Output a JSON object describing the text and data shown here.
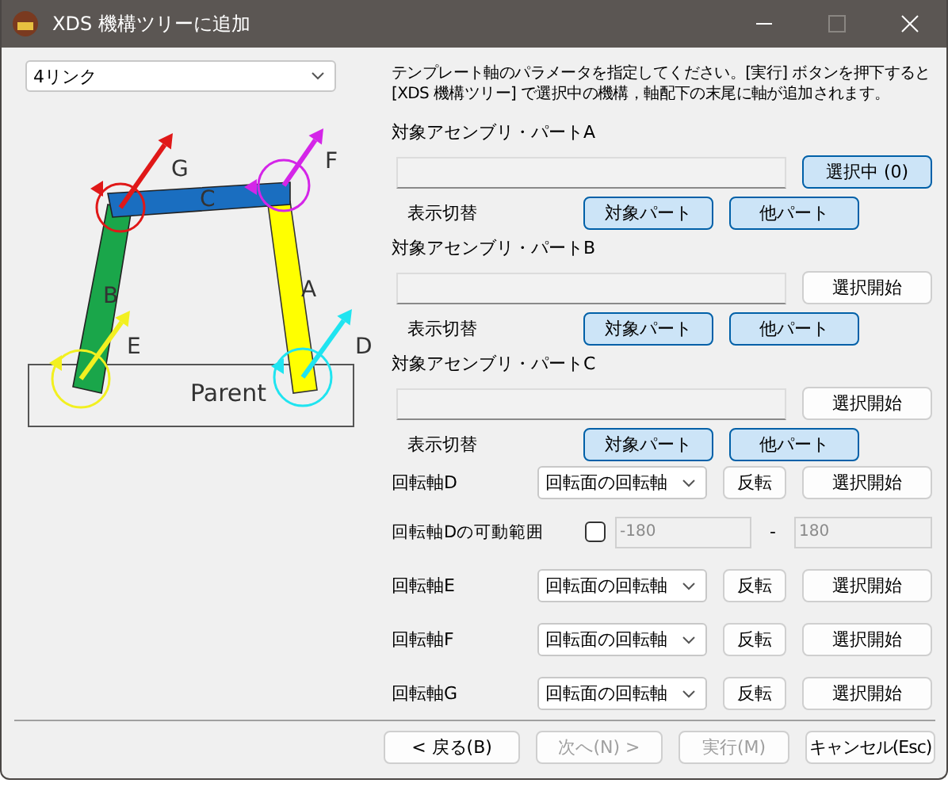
{
  "window": {
    "title": "XDS 機構ツリーに追加"
  },
  "preset": {
    "value": "4リンク"
  },
  "diagram": {
    "labels": [
      "G",
      "F",
      "C",
      "B",
      "A",
      "E",
      "D",
      "Parent"
    ]
  },
  "description": [
    "テンプレート軸のパラメータを指定してください。[実行] ボタンを押下すると",
    "[XDS 機構ツリー] で選択中の機構，軸配下の末尾に軸が追加されます。"
  ],
  "parts": [
    {
      "label": "対象アセンブリ・パートA",
      "button": {
        "label": "選択中 (0)",
        "selected": true
      },
      "display_label": "表示切替",
      "toggles": [
        {
          "label": "対象パート",
          "on": true
        },
        {
          "label": "他パート",
          "on": true
        }
      ]
    },
    {
      "label": "対象アセンブリ・パートB",
      "button": {
        "label": "選択開始",
        "selected": false
      },
      "display_label": "表示切替",
      "toggles": [
        {
          "label": "対象パート",
          "on": true
        },
        {
          "label": "他パート",
          "on": true
        }
      ]
    },
    {
      "label": "対象アセンブリ・パートC",
      "button": {
        "label": "選択開始",
        "selected": false
      },
      "display_label": "表示切替",
      "toggles": [
        {
          "label": "対象パート",
          "on": true
        },
        {
          "label": "他パート",
          "on": true
        }
      ]
    }
  ],
  "axis_rows": [
    {
      "kind": "axis",
      "label": "回転軸D",
      "mode": "回転面の回転軸",
      "reverse": "反転",
      "start": "選択開始"
    },
    {
      "kind": "range",
      "label": "回転軸Dの可動範囲",
      "checked": false,
      "min": "-180",
      "separator": "-",
      "max": "180"
    },
    {
      "kind": "axis",
      "label": "回転軸E",
      "mode": "回転面の回転軸",
      "reverse": "反転",
      "start": "選択開始"
    },
    {
      "kind": "axis",
      "label": "回転軸F",
      "mode": "回転面の回転軸",
      "reverse": "反転",
      "start": "選択開始"
    },
    {
      "kind": "axis",
      "label": "回転軸G",
      "mode": "回転面の回転軸",
      "reverse": "反転",
      "start": "選択開始"
    }
  ],
  "footer_buttons": [
    {
      "label": "< 戻る(B)",
      "disabled": false
    },
    {
      "label": "次へ(N) >",
      "disabled": true
    },
    {
      "label": "実行(M)",
      "disabled": true
    },
    {
      "label": "キャンセル(Esc)",
      "disabled": false
    }
  ]
}
